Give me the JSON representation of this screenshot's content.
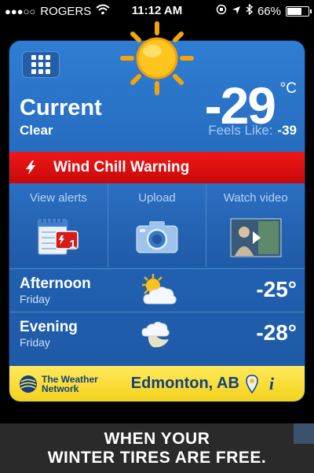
{
  "status_bar": {
    "carrier": "ROGERS",
    "signal_dots": "●●●○○",
    "time": "11:12 AM",
    "battery": "66%",
    "battery_level": 0.66
  },
  "widget": {
    "current_label": "Current",
    "condition": "Clear",
    "temperature": "-29",
    "unit": "°C",
    "feels_like_label": "Feels Like:",
    "feels_like_value": "-39",
    "warning": "Wind Chill Warning",
    "actions": [
      {
        "label": "View alerts",
        "badge": "1",
        "icon": "alerts-calendar-icon"
      },
      {
        "label": "Upload",
        "icon": "camera-icon"
      },
      {
        "label": "Watch video",
        "icon": "video-thumbnail-icon"
      }
    ],
    "forecast": [
      {
        "period": "Afternoon",
        "day": "Friday",
        "temp": "-25°",
        "icon": "partly-cloudy-icon"
      },
      {
        "period": "Evening",
        "day": "Friday",
        "temp": "-28°",
        "icon": "moon-cloud-icon"
      }
    ],
    "brand_line1": "The Weather",
    "brand_line2": "Network",
    "city": "Edmonton, AB",
    "info": "i"
  },
  "ad": {
    "line1": "WHEN YOUR",
    "line2": "WINTER TIRES ARE FREE."
  },
  "colors": {
    "card_blue": "#2467b9",
    "warning_red": "#d81010",
    "bar_yellow": "#f7dd34",
    "brand_navy": "#13407e"
  }
}
